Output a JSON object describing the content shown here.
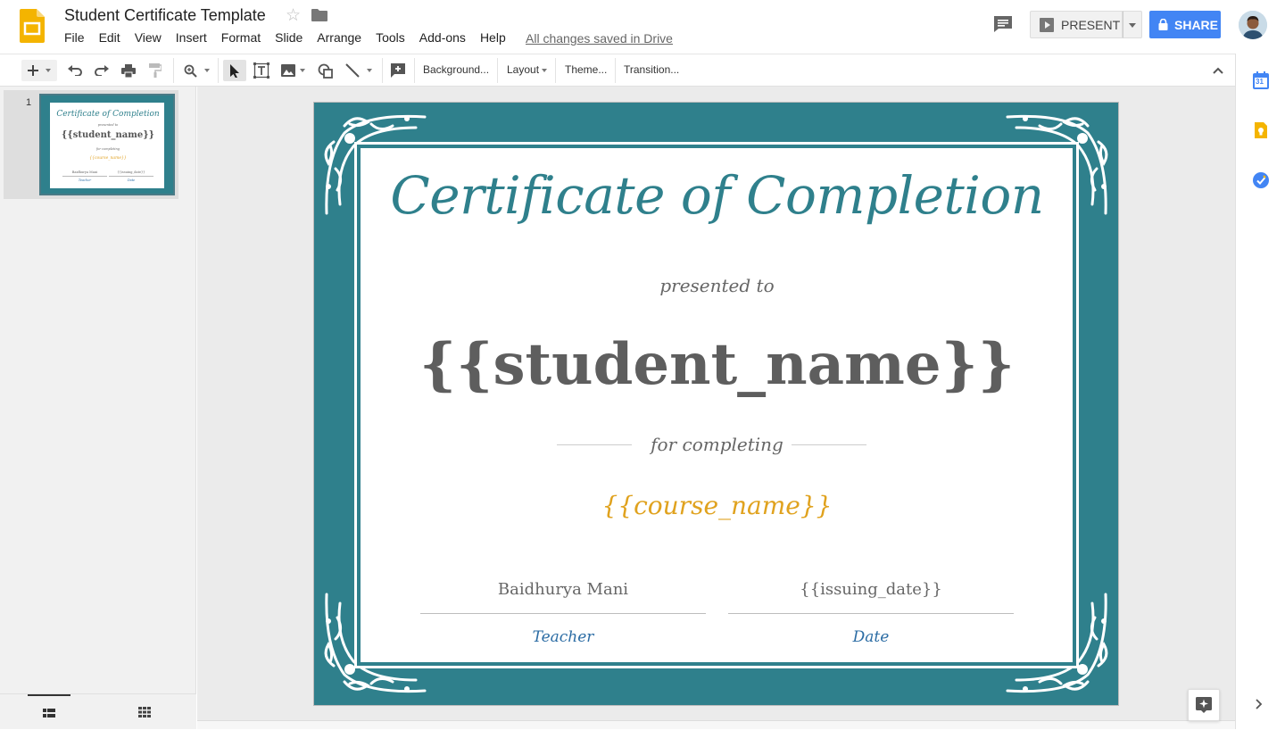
{
  "app": {
    "title": "Student Certificate Template",
    "save_status": "All changes saved in Drive",
    "accent": "#4285f4",
    "logo_color": "#f4b400"
  },
  "menu": [
    "File",
    "Edit",
    "View",
    "Insert",
    "Format",
    "Slide",
    "Arrange",
    "Tools",
    "Add-ons",
    "Help"
  ],
  "header_actions": {
    "present_label": "PRESENT",
    "share_label": "SHARE"
  },
  "toolbar": {
    "background_label": "Background...",
    "layout_label": "Layout",
    "theme_label": "Theme...",
    "transition_label": "Transition..."
  },
  "filmstrip": {
    "slide_number": "1"
  },
  "slide": {
    "border_color": "#2f808c",
    "title": "Certificate of Completion",
    "presented_to": "presented to",
    "student_name": "{{student_name}}",
    "for_completing": "for completing",
    "course_name": "{{course_name}}",
    "signature_left": "Baidhurya Mani",
    "signature_right": "{{issuing_date}}",
    "role_left": "Teacher",
    "role_right": "Date"
  },
  "side_panel": {
    "calendar_day": "31"
  }
}
